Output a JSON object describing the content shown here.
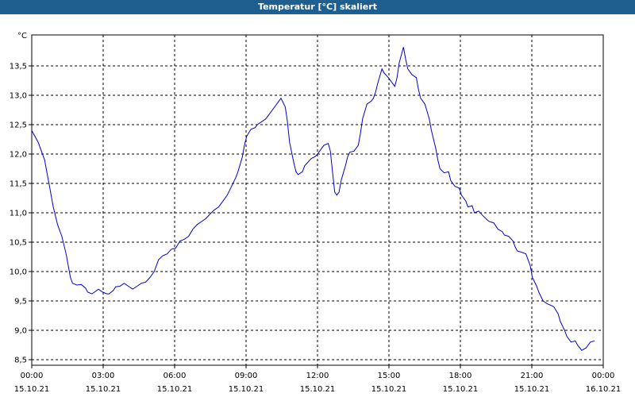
{
  "window": {
    "title": "Temperatur [°C] skaliert"
  },
  "chart_data": {
    "type": "line",
    "unit_label": "°C",
    "title": "Temperatur [°C] skaliert",
    "ylim": [
      8.5,
      14.0
    ],
    "yticks": [
      "8,5",
      "9,0",
      "9,5",
      "10,0",
      "10,5",
      "11,0",
      "11,5",
      "12,0",
      "12,5",
      "13,0",
      "13,5"
    ],
    "ytick_values": [
      8.5,
      9.0,
      9.5,
      10.0,
      10.5,
      11.0,
      11.5,
      12.0,
      12.5,
      13.0,
      13.5
    ],
    "xlim_hours": [
      0,
      24
    ],
    "xticks": [
      {
        "time": "00:00",
        "date": "15.10.21"
      },
      {
        "time": "03:00",
        "date": "15.10.21"
      },
      {
        "time": "06:00",
        "date": "15.10.21"
      },
      {
        "time": "09:00",
        "date": "15.10.21"
      },
      {
        "time": "12:00",
        "date": "15.10.21"
      },
      {
        "time": "15:00",
        "date": "15.10.21"
      },
      {
        "time": "18:00",
        "date": "15.10.21"
      },
      {
        "time": "21:00",
        "date": "15.10.21"
      },
      {
        "time": "00:00",
        "date": "16.10.21"
      }
    ],
    "grid": true,
    "line_color": "#0000cc",
    "series": [
      {
        "points": [
          [
            0.0,
            12.4
          ],
          [
            0.3,
            12.2
          ],
          [
            0.6,
            11.9
          ],
          [
            0.8,
            11.5
          ],
          [
            1.0,
            11.1
          ],
          [
            1.2,
            10.8
          ],
          [
            1.4,
            10.6
          ],
          [
            1.6,
            10.3
          ],
          [
            1.8,
            9.9
          ],
          [
            1.9,
            9.8
          ],
          [
            2.1,
            9.77
          ],
          [
            2.3,
            9.78
          ],
          [
            2.5,
            9.72
          ],
          [
            2.6,
            9.65
          ],
          [
            2.8,
            9.62
          ],
          [
            3.0,
            9.67
          ],
          [
            3.1,
            9.7
          ],
          [
            3.3,
            9.65
          ],
          [
            3.5,
            9.62
          ],
          [
            3.6,
            9.62
          ],
          [
            3.8,
            9.68
          ],
          [
            3.9,
            9.74
          ],
          [
            4.1,
            9.75
          ],
          [
            4.3,
            9.8
          ],
          [
            4.5,
            9.75
          ],
          [
            4.7,
            9.7
          ],
          [
            4.9,
            9.75
          ],
          [
            5.1,
            9.8
          ],
          [
            5.3,
            9.82
          ],
          [
            5.5,
            9.9
          ],
          [
            5.7,
            10.0
          ],
          [
            5.9,
            10.2
          ],
          [
            6.1,
            10.27
          ],
          [
            6.3,
            10.3
          ],
          [
            6.5,
            10.38
          ],
          [
            6.7,
            10.4
          ],
          [
            6.9,
            10.52
          ],
          [
            7.1,
            10.55
          ],
          [
            7.3,
            10.6
          ],
          [
            7.5,
            10.72
          ],
          [
            7.7,
            10.8
          ],
          [
            7.9,
            10.85
          ],
          [
            8.1,
            10.9
          ],
          [
            8.3,
            10.98
          ],
          [
            8.5,
            11.05
          ],
          [
            8.7,
            11.1
          ],
          [
            8.9,
            11.2
          ],
          [
            9.1,
            11.3
          ],
          [
            9.3,
            11.45
          ],
          [
            9.5,
            11.6
          ],
          [
            9.6,
            11.7
          ],
          [
            9.8,
            11.95
          ],
          [
            9.9,
            12.15
          ],
          [
            10.0,
            12.3
          ],
          [
            10.2,
            12.42
          ],
          [
            10.4,
            12.45
          ],
          [
            10.5,
            12.5
          ],
          [
            10.7,
            12.55
          ],
          [
            10.9,
            12.6
          ],
          [
            11.0,
            12.65
          ],
          [
            11.2,
            12.75
          ],
          [
            11.4,
            12.85
          ],
          [
            11.5,
            12.9
          ],
          [
            11.6,
            12.95
          ],
          [
            11.8,
            12.8
          ],
          [
            11.9,
            12.55
          ],
          [
            12.0,
            12.2
          ],
          [
            12.2,
            11.85
          ],
          [
            12.3,
            11.7
          ],
          [
            12.4,
            11.65
          ],
          [
            12.6,
            11.7
          ],
          [
            12.7,
            11.8
          ],
          [
            12.9,
            11.88
          ],
          [
            13.0,
            11.92
          ],
          [
            13.2,
            11.96
          ],
          [
            13.3,
            12.0
          ],
          [
            13.5,
            12.1
          ],
          [
            13.6,
            12.15
          ],
          [
            13.8,
            12.18
          ],
          [
            13.9,
            12.05
          ],
          [
            14.0,
            11.7
          ],
          [
            14.1,
            11.35
          ],
          [
            14.2,
            11.3
          ],
          [
            14.3,
            11.35
          ],
          [
            14.4,
            11.55
          ],
          [
            14.6,
            11.8
          ],
          [
            14.7,
            11.95
          ],
          [
            14.8,
            12.03
          ],
          [
            15.0,
            12.05
          ],
          [
            15.2,
            12.15
          ],
          [
            15.3,
            12.35
          ],
          [
            15.4,
            12.6
          ],
          [
            15.6,
            12.85
          ],
          [
            15.8,
            12.9
          ],
          [
            15.9,
            12.95
          ],
          [
            16.0,
            13.05
          ],
          [
            16.1,
            13.2
          ],
          [
            16.3,
            13.45
          ],
          [
            16.4,
            13.38
          ],
          [
            16.6,
            13.3
          ],
          [
            16.8,
            13.2
          ],
          [
            16.9,
            13.15
          ],
          [
            17.0,
            13.3
          ],
          [
            17.1,
            13.55
          ],
          [
            17.3,
            13.82
          ],
          [
            17.4,
            13.62
          ],
          [
            17.5,
            13.45
          ],
          [
            17.7,
            13.35
          ],
          [
            17.9,
            13.3
          ],
          [
            18.0,
            13.1
          ],
          [
            18.1,
            12.95
          ],
          [
            18.3,
            12.85
          ],
          [
            18.5,
            12.6
          ],
          [
            18.6,
            12.4
          ],
          [
            18.8,
            12.1
          ],
          [
            18.9,
            11.9
          ],
          [
            19.0,
            11.75
          ],
          [
            19.2,
            11.68
          ],
          [
            19.4,
            11.7
          ],
          [
            19.5,
            11.55
          ],
          [
            19.7,
            11.45
          ],
          [
            19.9,
            11.42
          ],
          [
            20.0,
            11.3
          ],
          [
            20.2,
            11.2
          ],
          [
            20.3,
            11.1
          ],
          [
            20.5,
            11.12
          ],
          [
            20.6,
            11.0
          ],
          [
            20.8,
            11.03
          ],
          [
            21.0,
            10.95
          ],
          [
            21.2,
            10.88
          ],
          [
            21.3,
            10.85
          ],
          [
            21.5,
            10.83
          ],
          [
            21.7,
            10.72
          ],
          [
            21.9,
            10.68
          ],
          [
            22.0,
            10.62
          ],
          [
            22.2,
            10.6
          ],
          [
            22.4,
            10.52
          ],
          [
            22.5,
            10.42
          ],
          [
            22.6,
            10.35
          ],
          [
            22.8,
            10.33
          ],
          [
            23.0,
            10.3
          ],
          [
            23.2,
            10.1
          ],
          [
            23.3,
            9.9
          ],
          [
            23.5,
            9.75
          ],
          [
            23.6,
            9.65
          ],
          [
            23.8,
            9.5
          ],
          [
            24.0,
            9.45
          ],
          [
            24.2,
            9.42
          ],
          [
            24.3,
            9.4
          ],
          [
            24.5,
            9.28
          ],
          [
            24.6,
            9.15
          ],
          [
            24.8,
            9.0
          ],
          [
            24.9,
            8.9
          ],
          [
            25.1,
            8.8
          ],
          [
            25.3,
            8.82
          ],
          [
            25.4,
            8.75
          ],
          [
            25.6,
            8.66
          ],
          [
            25.8,
            8.7
          ],
          [
            26.0,
            8.8
          ],
          [
            26.2,
            8.82
          ]
        ]
      }
    ]
  }
}
